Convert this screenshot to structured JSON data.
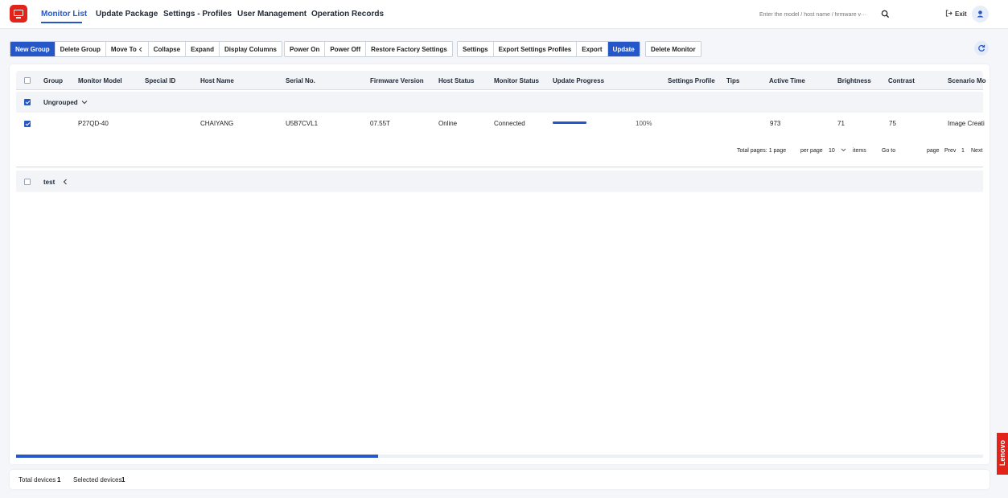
{
  "nav": {
    "tabs": [
      {
        "label": "Monitor List"
      },
      {
        "label": "Update Package"
      },
      {
        "label": "Settings - Profiles"
      },
      {
        "label": "User Management"
      },
      {
        "label": "Operation Records"
      }
    ],
    "active_tab": "Monitor List",
    "search_placeholder": "Enter the model / host name / firmware v···",
    "exit_label": "Exit",
    "brand_color": "#e2231a",
    "accent_color": "#2557c8"
  },
  "toolbar": {
    "group1": [
      "New Group",
      "Delete Group",
      "Move To",
      "Collapse",
      "Expand",
      "Display Columns"
    ],
    "group2": [
      "Power On",
      "Power Off",
      "Restore Factory Settings"
    ],
    "group3": [
      "Settings",
      "Export Settings Profiles",
      "Export",
      "Update"
    ],
    "group4": [
      "Delete Monitor"
    ]
  },
  "table": {
    "columns": [
      "Group",
      "Monitor Model",
      "Special ID",
      "Host Name",
      "Serial No.",
      "Firmware Version",
      "Host Status",
      "Monitor Status",
      "Update Progress",
      "Settings Profile",
      "Tips",
      "Active Time",
      "Brightness",
      "Contrast",
      "Scenario Mo"
    ],
    "groups": [
      {
        "name": "Ungrouped",
        "checked": true,
        "rows": [
          {
            "checked": true,
            "model": "P27QD-40",
            "host_name": "CHAIYANG",
            "serial": "U5B7CVL1",
            "firmware": "07.55T",
            "host_status": "Online",
            "monitor_status": "Connected",
            "progress": 100,
            "progress_label": "100%",
            "active_time": "973",
            "brightness": "71",
            "contrast": "75",
            "scenario": "Image Creati"
          }
        ],
        "pager": {
          "total_pages": "Total pages: 1 page",
          "per_page": "per page",
          "per_page_value": "10",
          "items": "items",
          "goto": "Go to",
          "page": "page",
          "prev": "Prev",
          "current": "1",
          "next": "Next"
        }
      },
      {
        "name": "test",
        "checked": false,
        "rows": []
      }
    ]
  },
  "footer": {
    "total_label": "Total devices",
    "total_value": "1",
    "selected_label": "Selected devices",
    "selected_value": "1"
  },
  "brand": {
    "side_label": "Lenovo"
  },
  "icons": {
    "logo": "monitor-icon",
    "search": "search-icon",
    "exit": "exit-icon",
    "user": "user-icon",
    "refresh": "refresh-icon",
    "expand": "chevron-down-icon",
    "collapsed": "chevron-left-icon"
  }
}
